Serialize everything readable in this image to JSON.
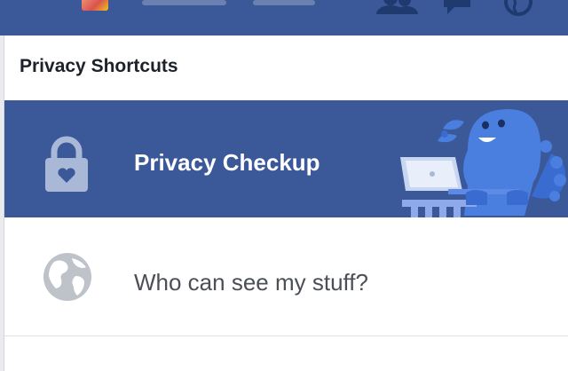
{
  "header": {
    "icons": [
      "friends-icon",
      "messages-icon",
      "globe-notifications-icon"
    ]
  },
  "section": {
    "title": "Privacy Shortcuts"
  },
  "items": [
    {
      "label": "Privacy Checkup",
      "icon": "lock-icon"
    },
    {
      "label": "Who can see my stuff?",
      "icon": "globe-icon"
    }
  ],
  "colors": {
    "brand": "#3b5998",
    "dino": "#4a7fe0",
    "panel_bg": "#ffffff",
    "title_text": "#1d2129",
    "body_text": "#4b4f56"
  }
}
